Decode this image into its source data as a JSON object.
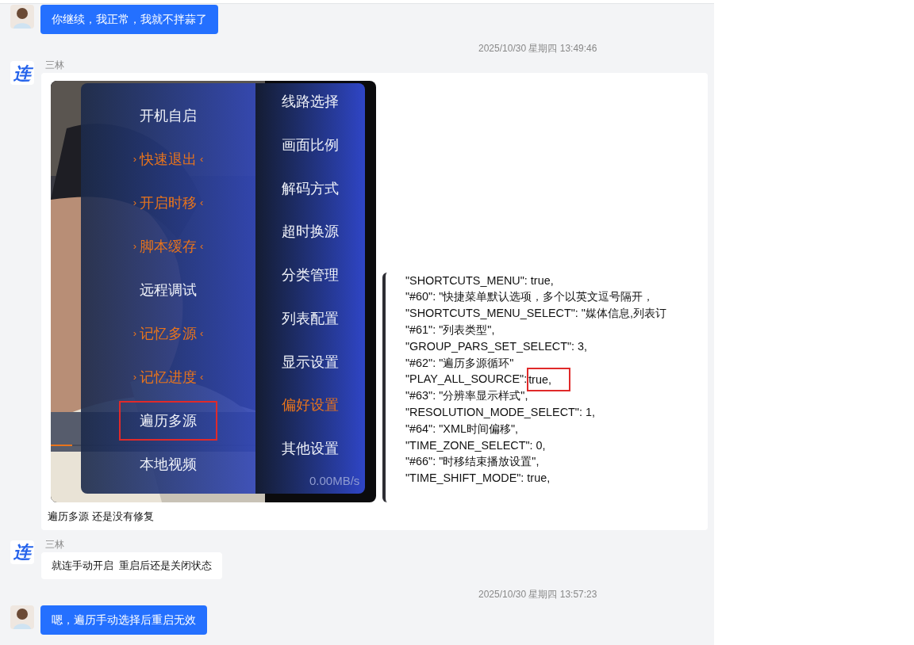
{
  "messages": [
    {
      "kind": "sent",
      "text": "你继续，我正常，我就不拌蒜了"
    },
    {
      "kind": "time",
      "text": "2025/10/30 星期四 13:49:46"
    },
    {
      "kind": "received",
      "sender": "三林",
      "logo_text": "连",
      "caption": "遍历多源 还是没有修复",
      "tv_menu": {
        "left_items": [
          {
            "label": "开机自启",
            "selected": false,
            "annotated": false
          },
          {
            "label": "快速退出",
            "selected": true,
            "annotated": false,
            "left_mark": "›",
            "right_mark": "‹"
          },
          {
            "label": "开启时移",
            "selected": true,
            "annotated": false,
            "left_mark": "›",
            "right_mark": "‹"
          },
          {
            "label": "脚本缓存",
            "selected": true,
            "annotated": false,
            "left_mark": "›",
            "right_mark": "‹"
          },
          {
            "label": "远程调试",
            "selected": false,
            "annotated": false
          },
          {
            "label": "记忆多源",
            "selected": true,
            "annotated": false,
            "left_mark": "›",
            "right_mark": "‹"
          },
          {
            "label": "记忆进度",
            "selected": true,
            "annotated": false,
            "left_mark": "›",
            "right_mark": "‹"
          },
          {
            "label": "遍历多源",
            "selected": false,
            "annotated": true
          },
          {
            "label": "本地视频",
            "selected": false,
            "annotated": false
          }
        ],
        "right_items": [
          {
            "label": "线路选择",
            "selected": false
          },
          {
            "label": "画面比例",
            "selected": false
          },
          {
            "label": "解码方式",
            "selected": false
          },
          {
            "label": "超时换源",
            "selected": false
          },
          {
            "label": "分类管理",
            "selected": false
          },
          {
            "label": "列表配置",
            "selected": false
          },
          {
            "label": "显示设置",
            "selected": false
          },
          {
            "label": "偏好设置",
            "selected": true
          },
          {
            "label": "其他设置",
            "selected": false
          }
        ],
        "progress": {
          "level": 0.1
        },
        "speed": "0.00MB/s"
      },
      "code_lines": [
        {
          "text": "\"SHORTCUTS_MENU\": true,"
        },
        {
          "text": "\"#60\": \"快捷菜单默认选项，多个以英文逗号隔开，"
        },
        {
          "text": "\"SHORTCUTS_MENU_SELECT\": \"媒体信息,列表订"
        },
        {
          "text": "\"#61\": \"列表类型\","
        },
        {
          "text": "\"GROUP_PARS_SET_SELECT\": 3,"
        },
        {
          "text": "\"#62\": \"遍历多源循环\""
        },
        {
          "text": "\"PLAY_ALL_SOURCE\":",
          "value": "true,",
          "annotated": true
        },
        {
          "text": "\"#63\": \"分辨率显示样式\","
        },
        {
          "text": "\"RESOLUTION_MODE_SELECT\": 1,"
        },
        {
          "text": "\"#64\": \"XML时间偏移\","
        },
        {
          "text": "\"TIME_ZONE_SELECT\": 0,"
        },
        {
          "text": "\"#66\": \"时移结束播放设置\","
        },
        {
          "text": "\"TIME_SHIFT_MODE\": true,"
        }
      ]
    },
    {
      "kind": "received",
      "sender": "三林",
      "logo_text": "连",
      "text": "就连手动开启  重启后还是关闭状态"
    },
    {
      "kind": "time",
      "text": "2025/10/30 星期四 13:57:23"
    },
    {
      "kind": "sent",
      "text": "嗯，遍历手动选择后重启无效"
    }
  ]
}
